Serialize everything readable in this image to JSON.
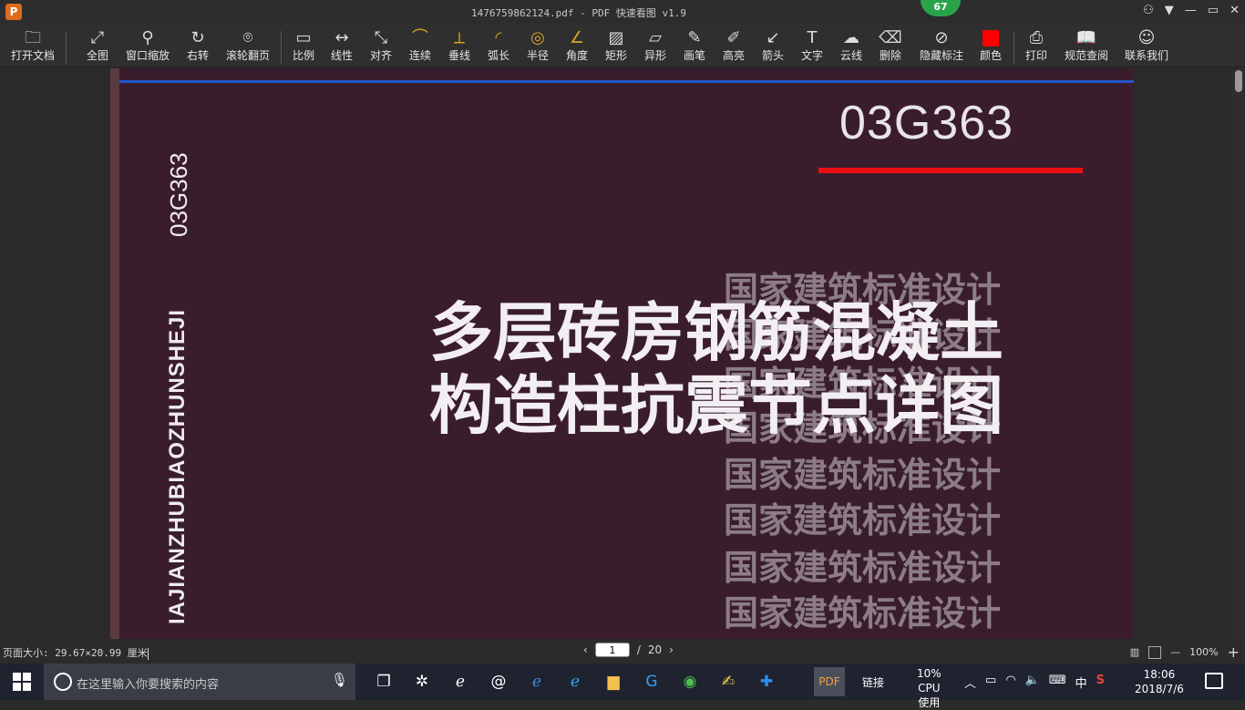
{
  "window": {
    "title": "1476759862124.pdf - PDF 快速看图 v1.9",
    "app_icon_letter": "P",
    "badge_count": "67",
    "controls": [
      "⚇",
      "▼",
      "—",
      "▭",
      "✕"
    ]
  },
  "toolbar": {
    "items": [
      {
        "label": "打开文档",
        "icon": "folder-icon"
      },
      {
        "label": "全图",
        "icon": "fit-icon"
      },
      {
        "label": "窗口缩放",
        "icon": "magnifier-icon"
      },
      {
        "label": "右转",
        "icon": "rotate-right-icon"
      },
      {
        "label": "滚轮翻页",
        "icon": "mouse-icon"
      },
      {
        "label": "比例",
        "icon": "scale-icon"
      },
      {
        "label": "线性",
        "icon": "linear-measure-icon"
      },
      {
        "label": "对齐",
        "icon": "aligned-measure-icon"
      },
      {
        "label": "连续",
        "icon": "continuous-measure-icon"
      },
      {
        "label": "垂线",
        "icon": "perpendicular-icon"
      },
      {
        "label": "弧长",
        "icon": "arc-length-icon"
      },
      {
        "label": "半径",
        "icon": "radius-icon"
      },
      {
        "label": "角度",
        "icon": "angle-icon"
      },
      {
        "label": "矩形",
        "icon": "rectangle-area-icon"
      },
      {
        "label": "异形",
        "icon": "polygon-area-icon"
      },
      {
        "label": "画笔",
        "icon": "pen-icon"
      },
      {
        "label": "高亮",
        "icon": "highlighter-icon"
      },
      {
        "label": "箭头",
        "icon": "arrow-icon"
      },
      {
        "label": "文字",
        "icon": "text-icon"
      },
      {
        "label": "云线",
        "icon": "cloud-line-icon"
      },
      {
        "label": "删除",
        "icon": "eraser-icon"
      },
      {
        "label": "隐藏标注",
        "icon": "hide-annotation-icon"
      },
      {
        "label": "颜色",
        "icon": "color-swatch-icon"
      },
      {
        "label": "打印",
        "icon": "printer-icon"
      },
      {
        "label": "规范查阅",
        "icon": "book-search-icon"
      },
      {
        "label": "联系我们",
        "icon": "contact-icon"
      }
    ],
    "color_swatch": "#ff0000"
  },
  "document": {
    "code": "03G363",
    "spine_pinyin": "GUOJIAJIANZHUBIAOZHUNSHEJI",
    "spine_visible": "IAJIANZHUBIAOZHUNSHEJI",
    "spine_code": "03G363",
    "title_line1": "多层砖房钢筋混凝土",
    "title_line2": "构造柱抗震节点详图",
    "watermark": "国家建筑标准设计",
    "colors": {
      "background": "#3a1d2d",
      "accent_line": "#ec0f0f",
      "top_line": "#2156c9"
    }
  },
  "status": {
    "page_size": "页面大小: 29.67×20.99 厘米",
    "current_page": "1",
    "separator": "/",
    "total_pages": "20",
    "zoom": "100%",
    "zoom_out": "—",
    "zoom_in": "+"
  },
  "taskbar": {
    "search_placeholder": "在这里输入你要搜索的内容",
    "active_app": "PDF",
    "link_label": "链接",
    "cpu_percent": "10%",
    "cpu_label": "CPU使用",
    "ime": "中",
    "time": "18:06",
    "date": "2018/7/6"
  }
}
